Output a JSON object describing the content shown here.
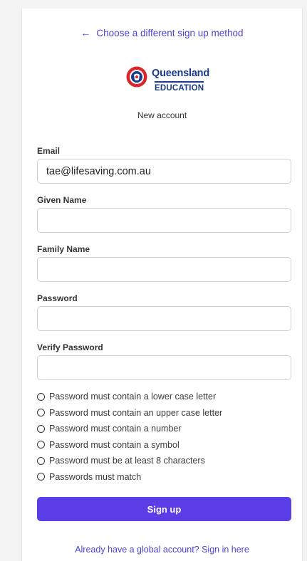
{
  "nav": {
    "back_arrow": "←",
    "back_label": "Choose a different sign up method"
  },
  "brand": {
    "name": "Queensland",
    "sub": "EDUCATION",
    "seal_icon": "lifesaving-seal-icon"
  },
  "subtitle": "New account",
  "form": {
    "email": {
      "label": "Email",
      "value": "tae@lifesaving.com.au",
      "placeholder": ""
    },
    "given_name": {
      "label": "Given Name",
      "value": "",
      "placeholder": ""
    },
    "family_name": {
      "label": "Family Name",
      "value": "",
      "placeholder": ""
    },
    "password": {
      "label": "Password",
      "value": "",
      "placeholder": ""
    },
    "verify_password": {
      "label": "Verify Password",
      "value": "",
      "placeholder": ""
    }
  },
  "password_rules": [
    "Password must contain a lower case letter",
    "Password must contain an upper case letter",
    "Password must contain a number",
    "Password must contain a symbol",
    "Password must be at least 8 characters",
    "Passwords must match"
  ],
  "actions": {
    "signup_label": "Sign up",
    "signin_link": "Already have a global account? Sign in here"
  },
  "colors": {
    "accent": "#5b3de8",
    "link": "#4a44d6",
    "brand_blue": "#1a3a8a",
    "seal_red": "#d8262c"
  }
}
